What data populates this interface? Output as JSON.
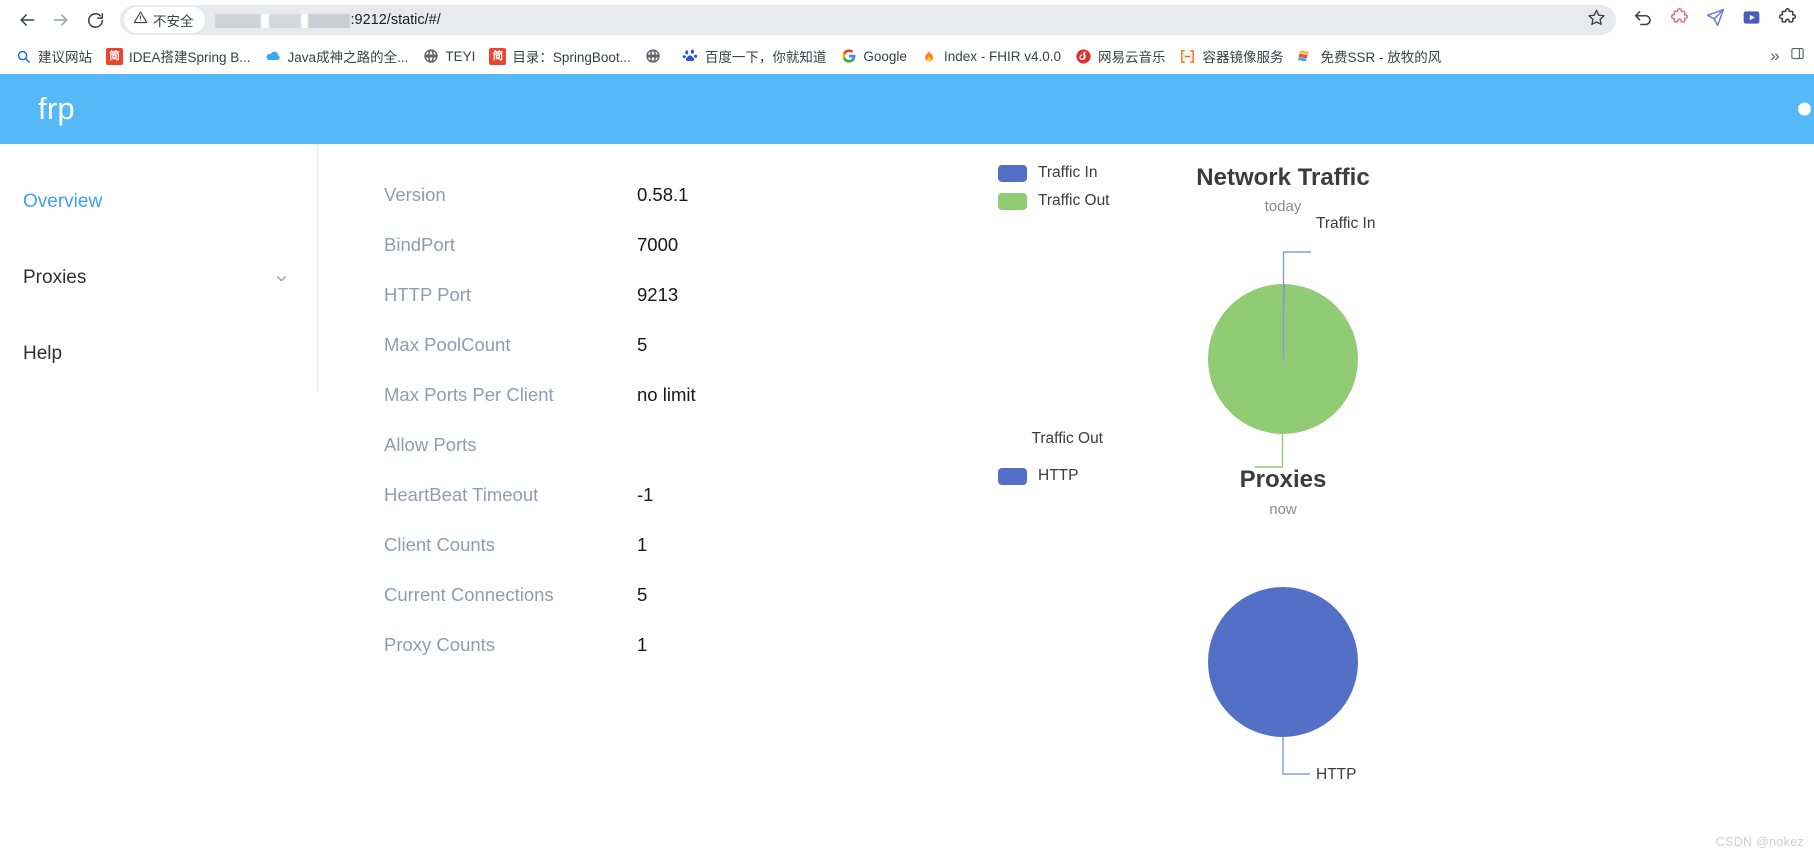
{
  "browser": {
    "back_icon": "back-arrow-icon",
    "forward_icon": "forward-arrow-icon",
    "reload_icon": "reload-icon",
    "security_label": "不安全",
    "url_text": ":9212/static/#/",
    "bookmark_star_icon": "star-icon",
    "toolbar_icons": [
      "undo-icon",
      "extension-puzzle-icon",
      "send-icon",
      "media-icon",
      "extensions-icon"
    ],
    "overflow_label": "»"
  },
  "bookmarks": [
    {
      "label": "建议网站",
      "icon": "search-icon"
    },
    {
      "label": "IDEA搭建Spring B...",
      "icon": "jianshu-icon"
    },
    {
      "label": "Java成神之路的全...",
      "icon": "cloud-icon"
    },
    {
      "label": "TEYI",
      "icon": "globe-icon"
    },
    {
      "label": "目录：SpringBoot...",
      "icon": "jianshu-icon"
    },
    {
      "label": "",
      "icon": "globe-icon"
    },
    {
      "label": "百度一下，你就知道",
      "icon": "baidu-icon"
    },
    {
      "label": "Google",
      "icon": "google-icon"
    },
    {
      "label": "Index - FHIR v4.0.0",
      "icon": "flame-icon"
    },
    {
      "label": "网易云音乐",
      "icon": "netease-music-icon"
    },
    {
      "label": "容器镜像服务",
      "icon": "container-registry-icon"
    },
    {
      "label": "免费SSR - 放牧的风",
      "icon": "flag-icon"
    }
  ],
  "app": {
    "logo": "frp",
    "header_color": "#55b9f7"
  },
  "sidebar": {
    "items": [
      {
        "label": "Overview",
        "active": true,
        "has_chevron": false
      },
      {
        "label": "Proxies",
        "active": false,
        "has_chevron": true
      },
      {
        "label": "Help",
        "active": false,
        "has_chevron": false
      }
    ]
  },
  "server_info": {
    "rows": [
      {
        "key": "Version",
        "value": "0.58.1"
      },
      {
        "key": "BindPort",
        "value": "7000"
      },
      {
        "key": "HTTP Port",
        "value": "9213"
      },
      {
        "key": "Max PoolCount",
        "value": "5"
      },
      {
        "key": "Max Ports Per Client",
        "value": "no limit"
      },
      {
        "key": "Allow Ports",
        "value": ""
      },
      {
        "key": "HeartBeat Timeout",
        "value": "-1"
      },
      {
        "key": "Client Counts",
        "value": "1"
      },
      {
        "key": "Current Connections",
        "value": "5"
      },
      {
        "key": "Proxy Counts",
        "value": "1"
      }
    ]
  },
  "chart_data": [
    {
      "type": "pie",
      "title": "Network Traffic",
      "subtitle": "today",
      "labels": [
        "Traffic In",
        "Traffic Out"
      ],
      "values": [
        1.2,
        98.8
      ],
      "colors": [
        "#5470c6",
        "#91cc75"
      ],
      "legend": [
        "Traffic In",
        "Traffic Out"
      ],
      "legend_position": "left",
      "annotations": [
        "Traffic In",
        "Traffic Out"
      ]
    },
    {
      "type": "pie",
      "title": "Proxies",
      "subtitle": "now",
      "labels": [
        "HTTP"
      ],
      "values": [
        100
      ],
      "colors": [
        "#5470c6"
      ],
      "legend": [
        "HTTP"
      ],
      "legend_position": "left",
      "annotations": [
        "HTTP"
      ]
    }
  ],
  "watermark": "CSDN @nokez"
}
